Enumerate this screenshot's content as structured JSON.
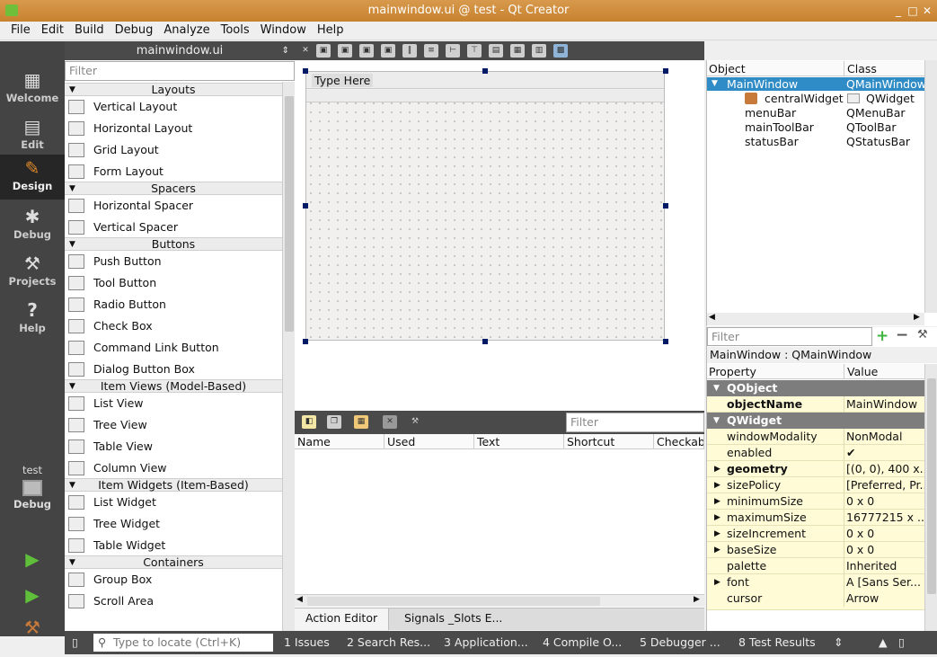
{
  "window": {
    "title": "mainwindow.ui @ test - Qt Creator"
  },
  "menu": [
    "File",
    "Edit",
    "Build",
    "Debug",
    "Analyze",
    "Tools",
    "Window",
    "Help"
  ],
  "modes": [
    {
      "label": "Welcome",
      "icon": "grid-icon"
    },
    {
      "label": "Edit",
      "icon": "document-icon"
    },
    {
      "label": "Design",
      "icon": "pencil-icon"
    },
    {
      "label": "Debug",
      "icon": "bug-icon"
    },
    {
      "label": "Projects",
      "icon": "wrench-icon"
    },
    {
      "label": "Help",
      "icon": "help-icon"
    }
  ],
  "kit": {
    "project": "test",
    "config": "Debug"
  },
  "widgetbox": {
    "file": "mainwindow.ui",
    "filter_placeholder": "Filter",
    "sections": [
      {
        "title": "Layouts",
        "items": [
          "Vertical Layout",
          "Horizontal Layout",
          "Grid Layout",
          "Form Layout"
        ]
      },
      {
        "title": "Spacers",
        "items": [
          "Horizontal Spacer",
          "Vertical Spacer"
        ]
      },
      {
        "title": "Buttons",
        "items": [
          "Push Button",
          "Tool Button",
          "Radio Button",
          "Check Box",
          "Command Link Button",
          "Dialog Button Box"
        ]
      },
      {
        "title": "Item Views (Model-Based)",
        "items": [
          "List View",
          "Tree View",
          "Table View",
          "Column View"
        ]
      },
      {
        "title": "Item Widgets (Item-Based)",
        "items": [
          "List Widget",
          "Tree Widget",
          "Table Widget"
        ]
      },
      {
        "title": "Containers",
        "items": [
          "Group Box",
          "Scroll Area"
        ]
      }
    ]
  },
  "form": {
    "menu_placeholder": "Type Here"
  },
  "action_editor": {
    "filter_placeholder": "Filter",
    "columns": [
      "Name",
      "Used",
      "Text",
      "Shortcut",
      "Checkable"
    ],
    "tabs": [
      "Action Editor",
      "Signals _Slots E..."
    ]
  },
  "object_inspector": {
    "columns": [
      "Object",
      "Class"
    ],
    "rows": [
      {
        "object": "MainWindow",
        "class": "QMainWindow",
        "level": 0,
        "selected": true
      },
      {
        "object": "centralWidget",
        "class": "QWidget",
        "level": 1
      },
      {
        "object": "menuBar",
        "class": "QMenuBar",
        "level": 1
      },
      {
        "object": "mainToolBar",
        "class": "QToolBar",
        "level": 1
      },
      {
        "object": "statusBar",
        "class": "QStatusBar",
        "level": 1
      }
    ]
  },
  "property_editor": {
    "filter_placeholder": "Filter",
    "caption": "MainWindow : QMainWindow",
    "columns": [
      "Property",
      "Value"
    ],
    "rows": [
      {
        "type": "group",
        "name": "QObject"
      },
      {
        "type": "prop",
        "name": "objectName",
        "value": "MainWindow",
        "bold": true
      },
      {
        "type": "group",
        "name": "QWidget"
      },
      {
        "type": "prop",
        "name": "windowModality",
        "value": "NonModal"
      },
      {
        "type": "prop",
        "name": "enabled",
        "value": "✔"
      },
      {
        "type": "prop",
        "name": "geometry",
        "value": "[(0, 0), 400 x...",
        "bold": true,
        "expand": true
      },
      {
        "type": "prop",
        "name": "sizePolicy",
        "value": "[Preferred, Pr...",
        "expand": true
      },
      {
        "type": "prop",
        "name": "minimumSize",
        "value": "0 x 0",
        "expand": true
      },
      {
        "type": "prop",
        "name": "maximumSize",
        "value": "16777215 x ...",
        "expand": true
      },
      {
        "type": "prop",
        "name": "sizeIncrement",
        "value": "0 x 0",
        "expand": true
      },
      {
        "type": "prop",
        "name": "baseSize",
        "value": "0 x 0",
        "expand": true
      },
      {
        "type": "prop",
        "name": "palette",
        "value": "Inherited"
      },
      {
        "type": "prop",
        "name": "font",
        "value": "A  [Sans Ser...",
        "expand": true
      },
      {
        "type": "prop",
        "name": "cursor",
        "value": "Arrow"
      }
    ]
  },
  "statusbar": {
    "locate_placeholder": "Type to locate (Ctrl+K)",
    "panes": [
      "1  Issues",
      "2  Search Res...",
      "3  Application...",
      "4  Compile O...",
      "5  Debugger ...",
      "8  Test Results"
    ]
  }
}
